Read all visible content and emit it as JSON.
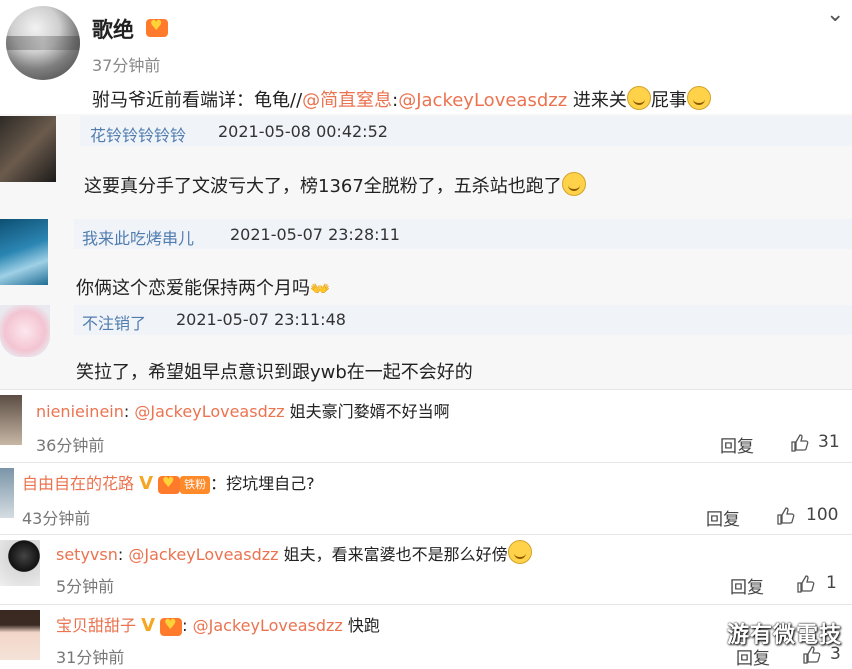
{
  "post": {
    "author": "歌绝",
    "time": "37分钟前",
    "content_pre": "驸马爷近前看端详：龟龟//",
    "mention1": "@简直窒息",
    "colon1": ":",
    "mention2": "@JackeyLoveasdzz",
    "content_post": " 进来关",
    "content_post2": "屁事"
  },
  "reposts": [
    {
      "name": "花铃铃铃铃铃",
      "time": "2021-05-08 00:42:52",
      "text": "这要真分手了文波亏大了，榜1367全脱粉了，五杀站也跑了"
    },
    {
      "name": "我来此吃烤串儿",
      "time": "2021-05-07 23:28:11",
      "text": "你俩这个恋爱能保持两个月吗"
    },
    {
      "name": "不注销了",
      "time": "2021-05-07 23:11:48",
      "text": "笑拉了，希望姐早点意识到跟ywb在一起不会好的"
    }
  ],
  "comments": [
    {
      "name": "nienieinein",
      "sep": ": ",
      "mention": "@JackeyLoveasdzz",
      "text": " 姐夫豪门婺婿不好当啊",
      "time": "36分钟前",
      "reply": "回复",
      "likes": "31"
    },
    {
      "name": "自由自在的花路",
      "badge": "铁粉",
      "sep": "：",
      "text": "挖坑埋自己?",
      "time": "43分钟前",
      "reply": "回复",
      "likes": "100"
    },
    {
      "name": "setyvsn",
      "sep": ": ",
      "mention": "@JackeyLoveasdzz",
      "text": " 姐夫，看来富婆也不是那么好傍",
      "time": "5分钟前",
      "reply": "回复",
      "likes": "1"
    },
    {
      "name": "宝贝甜甜子",
      "sep": ": ",
      "mention": "@JackeyLoveasdzz",
      "text": " 快跑",
      "time": "31分钟前",
      "reply": "回复",
      "likes": "3"
    }
  ],
  "watermark": "游有微電技",
  "icons": {
    "menu": "chevron-down-icon",
    "like": "thumb-up-icon",
    "fan": "fan-heart-icon",
    "verified": "v-icon"
  },
  "colors": {
    "link": "#507daf",
    "mention": "#eb7350",
    "repost_bg": "#f7f7f7"
  }
}
